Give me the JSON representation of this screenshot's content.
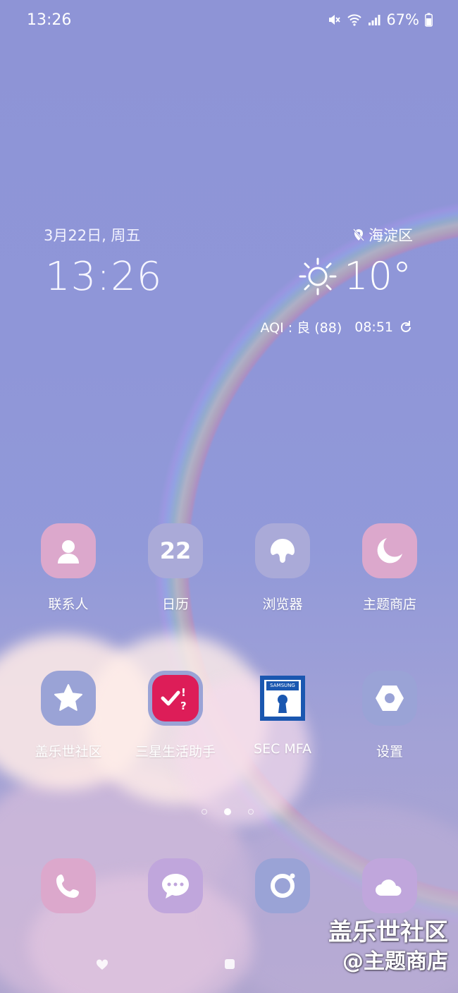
{
  "status_bar": {
    "time": "13:26",
    "battery": "67%"
  },
  "clock_widget": {
    "date": "3月22日, 周五",
    "time": "13:26"
  },
  "weather_widget": {
    "location": "海淀区",
    "temperature": "10°",
    "aqi": "AQI : 良 (88)",
    "updated": "08:51"
  },
  "apps_row1": [
    {
      "label": "联系人",
      "icon": "contact-icon",
      "color": "#dca8cc"
    },
    {
      "label": "日历",
      "icon": "calendar-icon",
      "date": "22",
      "color": "#aaaad8"
    },
    {
      "label": "浏览器",
      "icon": "browser-icon",
      "color": "#aaaad8"
    },
    {
      "label": "主题商店",
      "icon": "theme-store-icon",
      "color": "#dca8cc"
    }
  ],
  "apps_row2": [
    {
      "label": "盖乐世社区",
      "icon": "star-icon",
      "color": "#9aa3d6"
    },
    {
      "label": "三星生活助手",
      "icon": "life-assistant-icon",
      "color": "#dd1d58"
    },
    {
      "label": "SEC MFA",
      "icon": "sec-mfa-icon",
      "badge": "SAMSUNG",
      "color": "#1a57b0"
    },
    {
      "label": "设置",
      "icon": "settings-icon",
      "color": "#9aa3d6"
    }
  ],
  "dock": [
    {
      "icon": "phone-icon",
      "color": "#dca8cc"
    },
    {
      "icon": "messages-icon",
      "color": "#c0a6dc"
    },
    {
      "icon": "camera-icon",
      "color": "#9aa3d6"
    },
    {
      "icon": "weather-icon",
      "color": "#c0a6dc"
    }
  ],
  "watermark": {
    "line1": "盖乐世社区",
    "line2": "@主题商店"
  }
}
